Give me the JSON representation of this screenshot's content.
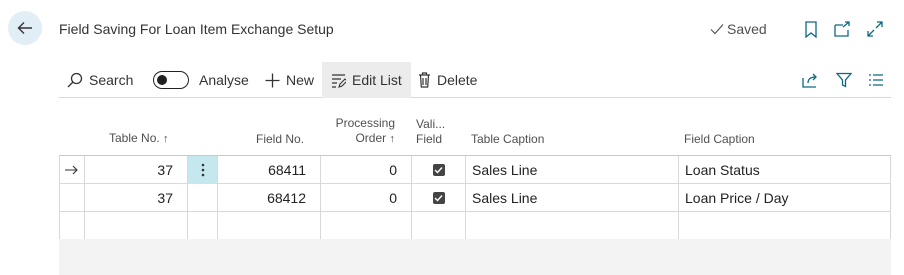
{
  "page": {
    "title": "Field Saving For Loan Item Exchange Setup",
    "saved_label": "Saved"
  },
  "actions": {
    "search": "Search",
    "analyse": "Analyse",
    "new": "New",
    "edit_list": "Edit List",
    "delete": "Delete"
  },
  "columns": {
    "table_no": "Table No.",
    "field_no": "Field No.",
    "processing_order_1": "Processing",
    "processing_order_2": "Order",
    "vali_1": "Vali...",
    "vali_2": "Field",
    "table_caption": "Table Caption",
    "field_caption": "Field Caption",
    "sort_arrow": "↑"
  },
  "rows": [
    {
      "table_no": "37",
      "field_no": "68411",
      "processing_order": "0",
      "validate": true,
      "table_caption": "Sales Line",
      "field_caption": "Loan Status"
    },
    {
      "table_no": "37",
      "field_no": "68412",
      "processing_order": "0",
      "validate": true,
      "table_caption": "Sales Line",
      "field_caption": "Loan Price / Day"
    }
  ],
  "icons": {
    "back": "arrow-left-icon",
    "saved": "check-icon",
    "bookmark": "bookmark-icon",
    "open_new": "open-in-new-window-icon",
    "expand": "expand-icon",
    "search": "search-icon",
    "new": "plus-icon",
    "edit_list": "edit-list-icon",
    "delete": "trash-icon",
    "share": "share-icon",
    "filter": "filter-icon",
    "list_view": "list-view-icon",
    "row_marker": "arrow-right-icon",
    "row_menu": "more-vertical-icon"
  },
  "colors": {
    "back_bg": "#e1eef5",
    "row_menu_bg": "#c5e8ef",
    "accent": "#0b6a83"
  }
}
